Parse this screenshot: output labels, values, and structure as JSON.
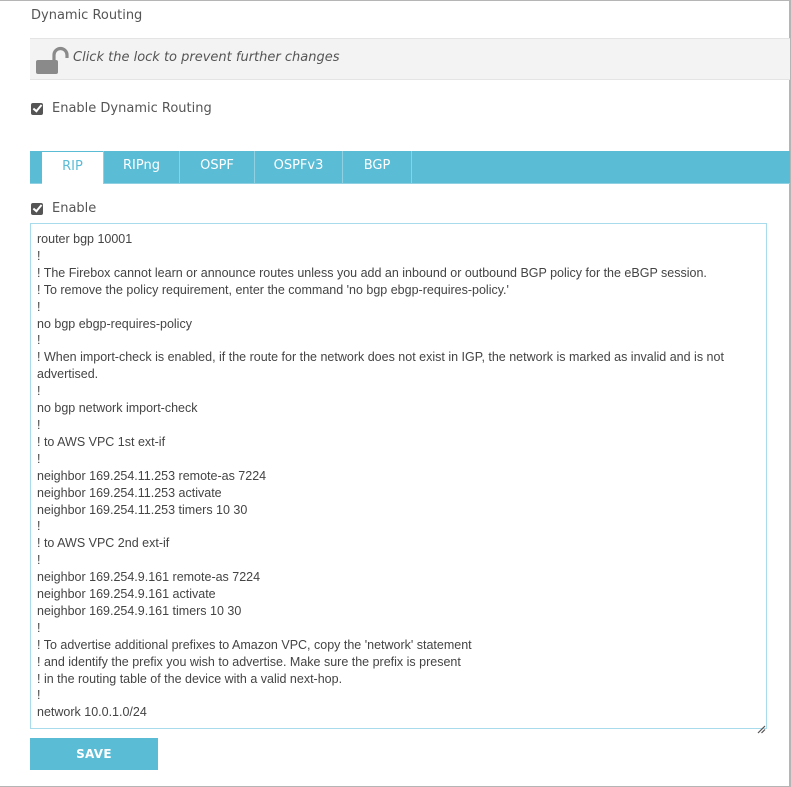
{
  "page": {
    "title": "Dynamic Routing"
  },
  "lock": {
    "icon": "unlocked-padlock-icon",
    "message": "Click the lock to prevent further changes"
  },
  "enable_dynamic_routing": {
    "label": "Enable Dynamic Routing",
    "checked": true
  },
  "tabs": [
    {
      "label": "RIP",
      "active": true
    },
    {
      "label": "RIPng",
      "active": false
    },
    {
      "label": "OSPF",
      "active": false
    },
    {
      "label": "OSPFv3",
      "active": false
    },
    {
      "label": "BGP",
      "active": false
    }
  ],
  "enable": {
    "label": "Enable",
    "checked": true
  },
  "config": {
    "lines": [
      "router bgp 10001",
      "!",
      "! The Firebox cannot learn or announce routes unless you add an inbound or outbound BGP policy for the eBGP session.",
      "! To remove the policy requirement, enter the command 'no bgp ebgp-requires-policy.'",
      "!",
      "no bgp ebgp-requires-policy",
      "!",
      "! When import-check is enabled, if the route for the network does not exist in IGP, the network is marked as invalid and is not advertised.",
      "!",
      "no bgp network import-check",
      "!",
      "! to AWS VPC 1st ext-if",
      "!",
      "neighbor 169.254.11.253 remote-as 7224",
      "neighbor 169.254.11.253 activate",
      "neighbor 169.254.11.253 timers 10 30",
      "!",
      "! to AWS VPC 2nd ext-if",
      "!",
      "neighbor 169.254.9.161 remote-as 7224",
      "neighbor 169.254.9.161 activate",
      "neighbor 169.254.9.161 timers 10 30",
      "!",
      "! To advertise additional prefixes to Amazon VPC, copy the 'network' statement",
      "! and identify the prefix you wish to advertise. Make sure the prefix is present",
      "! in the routing table of the device with a valid next-hop.",
      "!",
      "network 10.0.1.0/24"
    ]
  },
  "buttons": {
    "save_label": "SAVE"
  },
  "colors": {
    "accent": "#5bbcd6",
    "lock_bar": "#f3f3f3",
    "textarea_border": "#a8dced"
  }
}
